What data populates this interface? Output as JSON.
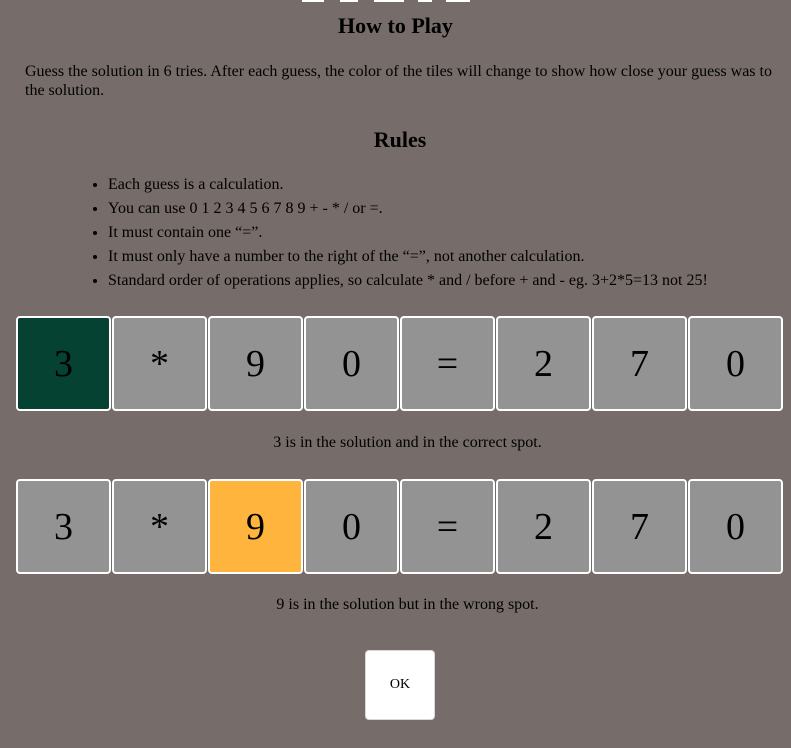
{
  "modal": {
    "title": "How to Play",
    "intro": "Guess the solution in 6 tries. After each guess, the color of the tiles will change to show how close your guess was to the solution.",
    "rules_title": "Rules",
    "rules": [
      "Each guess is a calculation.",
      "You can use 0 1 2 3 4 5 6 7 8 9 + - * / or =.",
      "It must contain one “=”.",
      "It must only have a number to the right of the “=”, not another calculation.",
      "Standard order of operations applies, so calculate * and / before + and - eg. 3+2*5=13 not 25!"
    ],
    "examples": [
      {
        "tiles": [
          "3",
          "*",
          "9",
          "0",
          "=",
          "2",
          "7",
          "0"
        ],
        "states": [
          "correct",
          "absent",
          "absent",
          "absent",
          "absent",
          "absent",
          "absent",
          "absent"
        ],
        "caption": "3 is in the solution and in the correct spot."
      },
      {
        "tiles": [
          "3",
          "*",
          "9",
          "0",
          "=",
          "2",
          "7",
          "0"
        ],
        "states": [
          "absent",
          "absent",
          "present",
          "absent",
          "absent",
          "absent",
          "absent",
          "absent"
        ],
        "caption": "9 is in the solution but in the wrong spot."
      }
    ],
    "ok_label": "OK"
  },
  "colors": {
    "overlay": "#766c69",
    "correct": "#054232",
    "present": "#ffb43d",
    "absent": "#939393",
    "tile_border": "#ffffff"
  }
}
